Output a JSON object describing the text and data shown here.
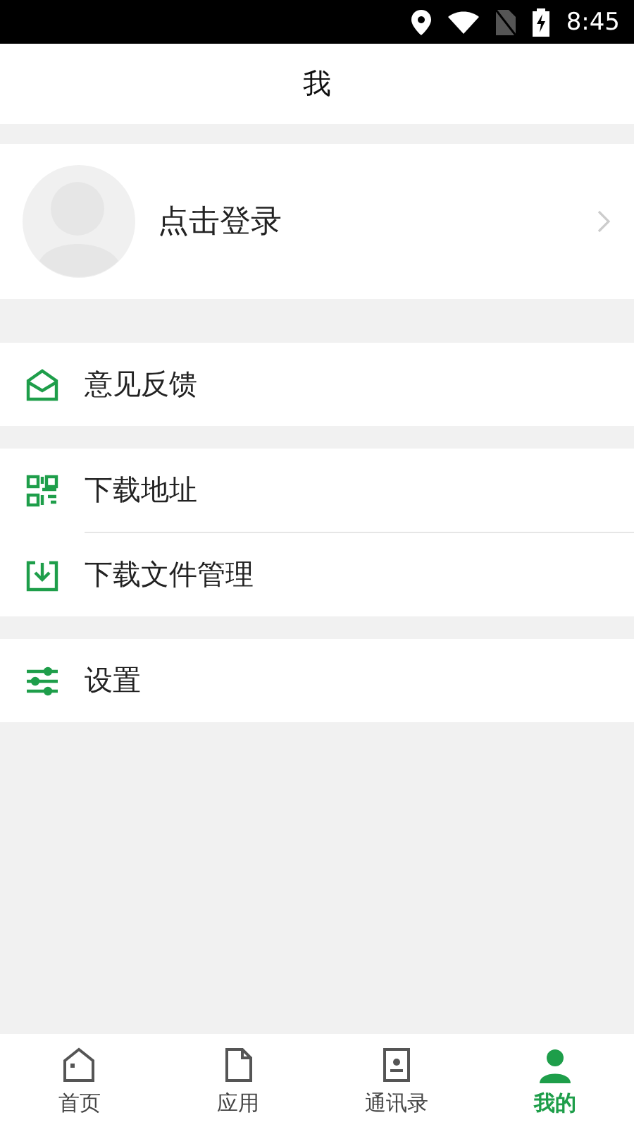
{
  "status_bar": {
    "time": "8:45"
  },
  "header": {
    "title": "我"
  },
  "profile": {
    "label": "点击登录"
  },
  "menu_groups": [
    {
      "items": [
        {
          "kind": "feedback",
          "label": "意见反馈"
        }
      ]
    },
    {
      "items": [
        {
          "kind": "qrcode",
          "label": "下载地址"
        },
        {
          "kind": "download",
          "label": "下载文件管理"
        }
      ]
    },
    {
      "items": [
        {
          "kind": "settings",
          "label": "设置"
        }
      ]
    }
  ],
  "tabs": [
    {
      "kind": "home",
      "label": "首页",
      "selected": false
    },
    {
      "kind": "apps",
      "label": "应用",
      "selected": false
    },
    {
      "kind": "contacts",
      "label": "通讯录",
      "selected": false
    },
    {
      "kind": "me",
      "label": "我的",
      "selected": true
    }
  ]
}
